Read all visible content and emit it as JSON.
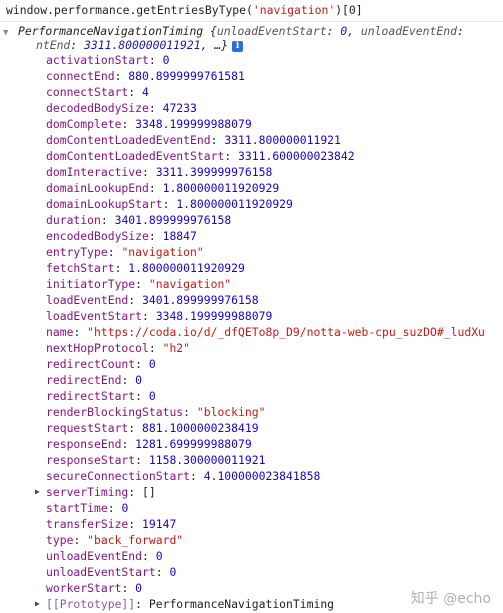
{
  "console": {
    "command_prefix": "window.performance.getEntriesByType(",
    "command_arg": "'navigation'",
    "command_suffix": ")[0]",
    "summary_class": "PerformanceNavigationTiming",
    "summary_open": " {",
    "summary_key1": "unloadEventStart",
    "summary_colon1": ": ",
    "summary_val1": "0",
    "summary_sep1": ", ",
    "summary_key2": "unloadEventEnd",
    "summary_colon2": ":",
    "summary_key2_tail": "ntEnd",
    "summary_colon3": ": ",
    "summary_val2": "3311.800000011921",
    "summary_close": ", …}",
    "info_badge": "i",
    "expand_arrow": "▼",
    "collapsed_arrow": "▶"
  },
  "properties": [
    {
      "key": "activationStart",
      "value": "0",
      "type": "num"
    },
    {
      "key": "connectEnd",
      "value": "880.8999999761581",
      "type": "num"
    },
    {
      "key": "connectStart",
      "value": "4",
      "type": "num"
    },
    {
      "key": "decodedBodySize",
      "value": "47233",
      "type": "num"
    },
    {
      "key": "domComplete",
      "value": "3348.199999988079",
      "type": "num"
    },
    {
      "key": "domContentLoadedEventEnd",
      "value": "3311.800000011921",
      "type": "num"
    },
    {
      "key": "domContentLoadedEventStart",
      "value": "3311.600000023842",
      "type": "num"
    },
    {
      "key": "domInteractive",
      "value": "3311.399999976158",
      "type": "num"
    },
    {
      "key": "domainLookupEnd",
      "value": "1.800000011920929",
      "type": "num"
    },
    {
      "key": "domainLookupStart",
      "value": "1.800000011920929",
      "type": "num"
    },
    {
      "key": "duration",
      "value": "3401.899999976158",
      "type": "num"
    },
    {
      "key": "encodedBodySize",
      "value": "18847",
      "type": "num"
    },
    {
      "key": "entryType",
      "value": "\"navigation\"",
      "type": "str"
    },
    {
      "key": "fetchStart",
      "value": "1.800000011920929",
      "type": "num"
    },
    {
      "key": "initiatorType",
      "value": "\"navigation\"",
      "type": "str"
    },
    {
      "key": "loadEventEnd",
      "value": "3401.899999976158",
      "type": "num"
    },
    {
      "key": "loadEventStart",
      "value": "3348.199999988079",
      "type": "num"
    },
    {
      "key": "name",
      "value": "\"https://coda.io/d/_dfQETo8p_D9/notta-web-cpu_suzDO#_ludXu",
      "type": "str"
    },
    {
      "key": "nextHopProtocol",
      "value": "\"h2\"",
      "type": "str"
    },
    {
      "key": "redirectCount",
      "value": "0",
      "type": "num"
    },
    {
      "key": "redirectEnd",
      "value": "0",
      "type": "num"
    },
    {
      "key": "redirectStart",
      "value": "0",
      "type": "num"
    },
    {
      "key": "renderBlockingStatus",
      "value": "\"blocking\"",
      "type": "str"
    },
    {
      "key": "requestStart",
      "value": "881.1000000238419",
      "type": "num"
    },
    {
      "key": "responseEnd",
      "value": "1281.699999988079",
      "type": "num"
    },
    {
      "key": "responseStart",
      "value": "1158.300000011921",
      "type": "num"
    },
    {
      "key": "secureConnectionStart",
      "value": "4.100000023841858",
      "type": "num"
    },
    {
      "key": "serverTiming",
      "value": "[]",
      "type": "plain",
      "expandable": true
    },
    {
      "key": "startTime",
      "value": "0",
      "type": "num"
    },
    {
      "key": "transferSize",
      "value": "19147",
      "type": "num"
    },
    {
      "key": "type",
      "value": "\"back_forward\"",
      "type": "str"
    },
    {
      "key": "unloadEventEnd",
      "value": "0",
      "type": "num"
    },
    {
      "key": "unloadEventStart",
      "value": "0",
      "type": "num"
    },
    {
      "key": "workerStart",
      "value": "0",
      "type": "num"
    },
    {
      "key": "[[Prototype]]",
      "value": "PerformanceNavigationTiming",
      "type": "plain",
      "expandable": true,
      "dim": true
    }
  ],
  "watermark": "知乎 @echo",
  "colors": {
    "key": "#881280",
    "number": "#1c00cf",
    "string": "#c41a16",
    "info_badge": "#2b6fd6"
  }
}
